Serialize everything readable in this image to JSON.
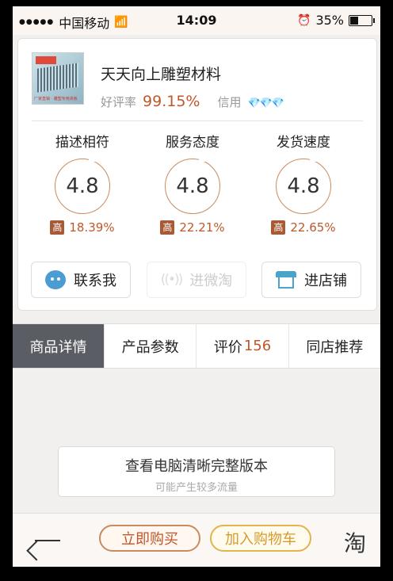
{
  "status_bar": {
    "carrier": "中国移动",
    "time": "14:09",
    "battery": "35%",
    "signal_dots": "●●●●●",
    "battery_level": 0.35
  },
  "shop": {
    "name": "天天向上雕塑材料",
    "rating_label": "好评率",
    "rating_value": "99.15%",
    "credit_label": "信用",
    "credit_icons": "💎💎💎"
  },
  "scores": [
    {
      "label": "描述相符",
      "value": "4.8",
      "badge": "高",
      "percent": "18.39%"
    },
    {
      "label": "服务态度",
      "value": "4.8",
      "badge": "高",
      "percent": "22.21%"
    },
    {
      "label": "发货速度",
      "value": "4.8",
      "badge": "高",
      "percent": "22.65%"
    }
  ],
  "actions": {
    "contact": "联系我",
    "weitao": "进微淘",
    "store": "进店铺"
  },
  "tabs": [
    {
      "label": "商品详情"
    },
    {
      "label": "产品参数"
    },
    {
      "label": "评价",
      "count": "156"
    },
    {
      "label": "同店推荐"
    }
  ],
  "pc_version": {
    "title": "查看电脑清晰完整版本",
    "subtitle": "可能产生较多流量"
  },
  "bottom": {
    "buy_now": "立即购买",
    "add_cart": "加入购物车",
    "taobao_icon": "淘"
  },
  "colors": {
    "accent": "#c0572a",
    "active_tab": "#5a5d63",
    "cart": "#e3b34d"
  }
}
